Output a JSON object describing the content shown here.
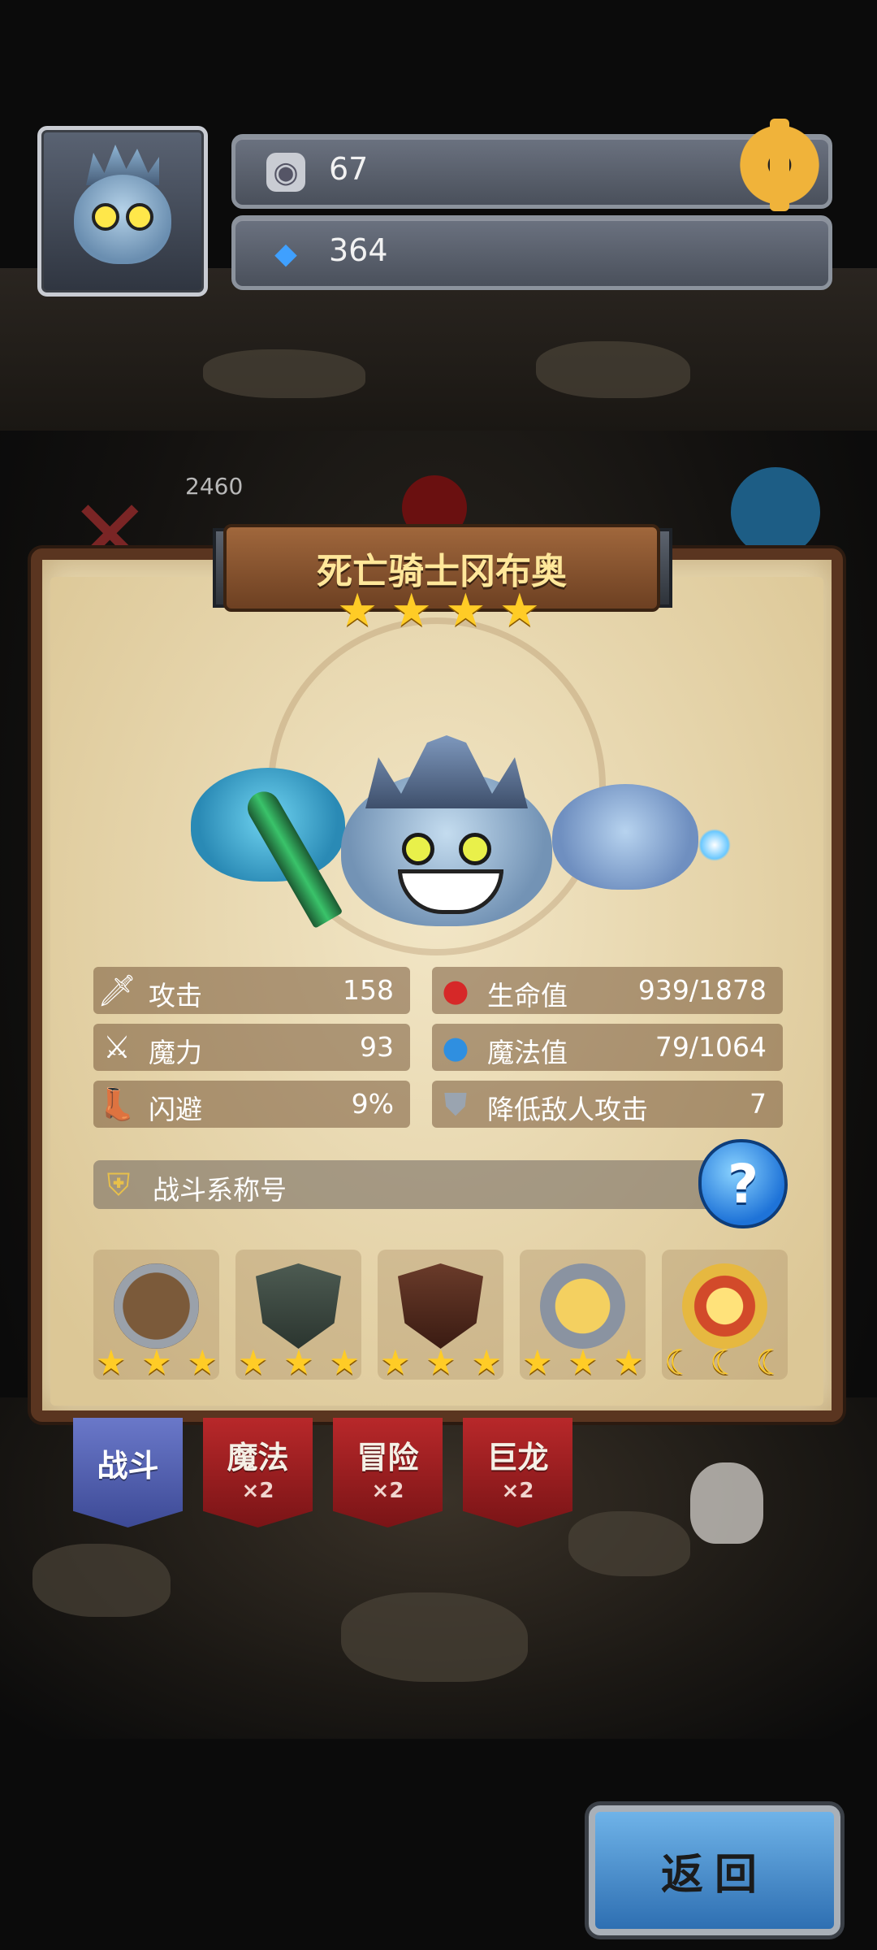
{
  "hud": {
    "coin_value": "67",
    "gem_value": "364",
    "coin_icon": "rune-coin-icon",
    "gem_icon": "blue-gem-icon"
  },
  "background": {
    "ghost_value": "2460"
  },
  "hero": {
    "name": "死亡骑士冈布奥",
    "stars": [
      "★",
      "★",
      "★",
      "★"
    ]
  },
  "stats": {
    "attack_label": "攻击",
    "attack_value": "158",
    "magic_label": "魔力",
    "magic_value": "93",
    "dodge_label": "闪避",
    "dodge_value": "9%",
    "hp_label": "生命值",
    "hp_value": "939/1878",
    "mp_label": "魔法值",
    "mp_value": "79/1064",
    "reduce_label": "降低敌人攻击",
    "reduce_value": "7"
  },
  "title_section": {
    "label": "战斗系称号",
    "help": "?"
  },
  "badges": [
    {
      "icon": "dagger-shield-badge-icon",
      "rating": [
        "★",
        "★",
        "★"
      ]
    },
    {
      "icon": "green-dagger-badge-icon",
      "rating": [
        "★",
        "★",
        "★"
      ]
    },
    {
      "icon": "ornate-shield-badge-icon",
      "rating": [
        "★",
        "★",
        "★"
      ]
    },
    {
      "icon": "laurel-cross-badge-icon",
      "rating": [
        "★",
        "★",
        "★"
      ]
    },
    {
      "icon": "crowned-gem-badge-icon",
      "rating": [
        "☾",
        "☾",
        "☾"
      ]
    }
  ],
  "tabs": [
    {
      "label": "战斗",
      "mult": ""
    },
    {
      "label": "魔法",
      "mult": "×2"
    },
    {
      "label": "冒险",
      "mult": "×2"
    },
    {
      "label": "巨龙",
      "mult": "×2"
    }
  ],
  "back_button": "返回",
  "colors": {
    "accent_gold": "#ffcc26",
    "parchment": "#e6d6ad",
    "active_tab": "#4a58ad",
    "inactive_tab": "#a01e20",
    "back_button": "#3f8ad0"
  }
}
